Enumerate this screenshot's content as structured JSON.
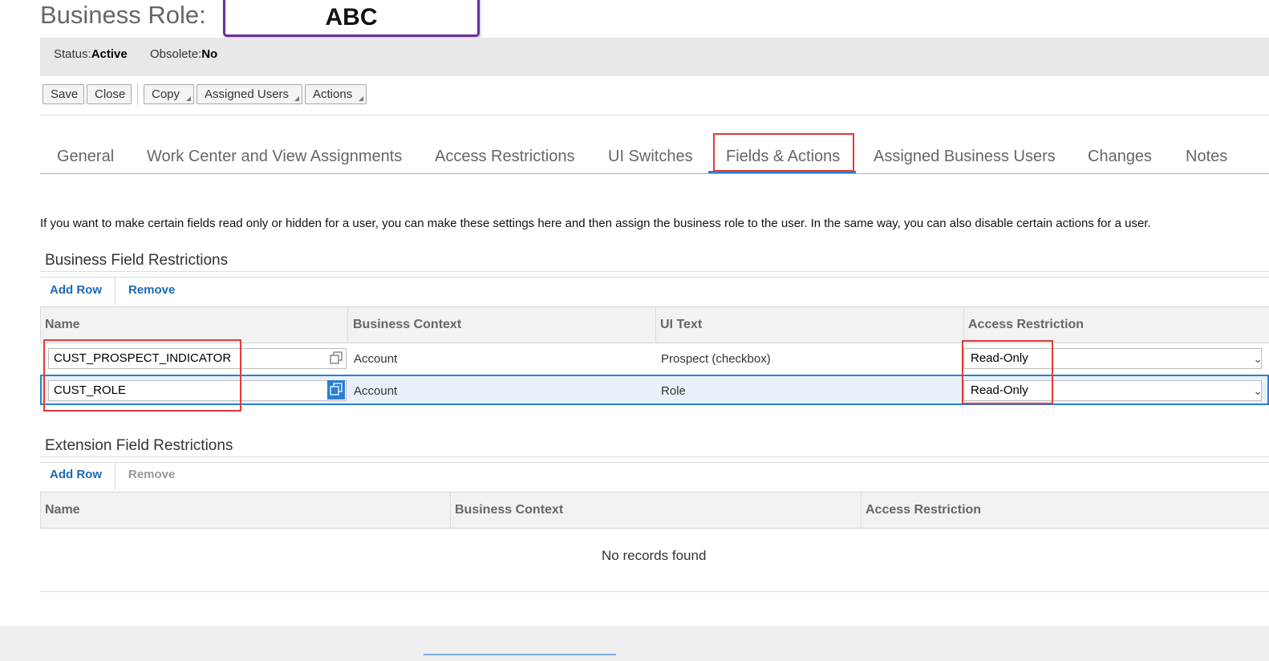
{
  "header": {
    "title": "Business Role:",
    "role_name": "ABC"
  },
  "status": {
    "status_label": "Status:",
    "status_value": "Active",
    "obsolete_label": "Obsolete:",
    "obsolete_value": "No"
  },
  "toolbar": {
    "save": "Save",
    "close": "Close",
    "copy": "Copy",
    "assigned_users": "Assigned Users",
    "actions": "Actions"
  },
  "tabs": [
    {
      "label": "General"
    },
    {
      "label": "Work Center and View Assignments"
    },
    {
      "label": "Access Restrictions"
    },
    {
      "label": "UI Switches"
    },
    {
      "label": "Fields & Actions",
      "active": true
    },
    {
      "label": "Assigned Business Users"
    },
    {
      "label": "Changes"
    },
    {
      "label": "Notes"
    }
  ],
  "description": "If you want to make certain fields read only or hidden for a user, you can make these settings here and then assign the business role to the user. In the same way, you can also disable certain actions for a user.",
  "business_fields": {
    "title": "Business Field Restrictions",
    "add_row": "Add Row",
    "remove": "Remove",
    "columns": [
      "Name",
      "Business Context",
      "UI Text",
      "Access Restriction"
    ],
    "rows": [
      {
        "name": "CUST_PROSPECT_INDICATOR",
        "context": "Account",
        "ui_text": "Prospect (checkbox)",
        "restriction": "Read-Only"
      },
      {
        "name": "CUST_ROLE",
        "context": "Account",
        "ui_text": "Role",
        "restriction": "Read-Only",
        "selected": true
      }
    ]
  },
  "extension_fields": {
    "title": "Extension Field Restrictions",
    "add_row": "Add Row",
    "remove": "Remove",
    "columns": [
      "Name",
      "Business Context",
      "Access Restriction"
    ],
    "empty_text": "No records found"
  },
  "colors": {
    "accent": "#2a7fd4",
    "link": "#1a6ab8",
    "highlight": "#e53935",
    "role_box": "#6b2f9e"
  }
}
